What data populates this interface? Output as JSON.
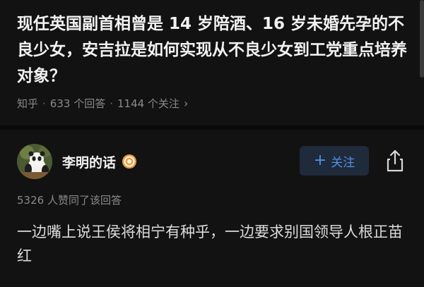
{
  "question": {
    "title": "现任英国副首相曾是 14 岁陪酒、16 岁未婚先孕的不良少女，安吉拉是如何实现从不良少女到工党重点培养对象？",
    "source": "知乎",
    "answers_count": "633 个回答",
    "followers_count": "1144 个关注"
  },
  "author": {
    "name": "李明的话",
    "follow_label": "关注"
  },
  "answer": {
    "upvote_summary": "5326 人赞同了该回答",
    "content": "一边嘴上说王侯将相宁有种乎，一边要求别国领导人根正苗红"
  },
  "colors": {
    "background": "#121212",
    "accent_blue": "#4e8fe8",
    "muted_text": "#8a8a8a"
  },
  "icons": {
    "badge": "badge-icon",
    "share": "share-icon",
    "chevron": "chevron-right-icon"
  }
}
